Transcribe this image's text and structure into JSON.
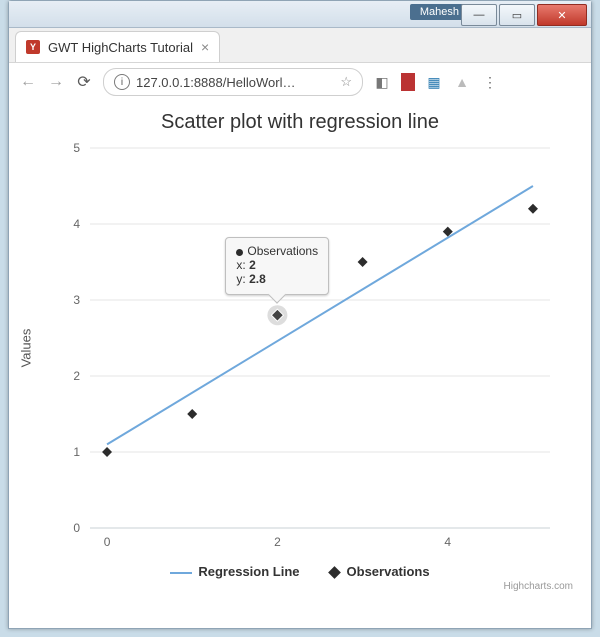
{
  "window": {
    "user": "Mahesh"
  },
  "tab": {
    "title": "GWT HighCharts Tutorial"
  },
  "address": {
    "url": "127.0.0.1:8888/HelloWorl…"
  },
  "chart_data": {
    "type": "scatter",
    "title": "Scatter plot with regression line",
    "xlabel": "",
    "ylabel": "Values",
    "xlim": [
      -0.2,
      5.2
    ],
    "ylim": [
      0,
      5
    ],
    "xticks": [
      0,
      2,
      4
    ],
    "yticks": [
      0,
      1,
      2,
      3,
      4,
      5
    ],
    "series": [
      {
        "name": "Regression Line",
        "type": "line",
        "color": "#6fa8dc",
        "data": [
          [
            0,
            1.1
          ],
          [
            5,
            4.5
          ]
        ]
      },
      {
        "name": "Observations",
        "type": "scatter",
        "color": "#2c2c2c",
        "data": [
          [
            0,
            1.0
          ],
          [
            1,
            1.5
          ],
          [
            2,
            2.8
          ],
          [
            3,
            3.5
          ],
          [
            4,
            3.9
          ],
          [
            5,
            4.2
          ]
        ]
      }
    ],
    "legend": [
      "Regression Line",
      "Observations"
    ],
    "credits": "Highcharts.com"
  },
  "tooltip": {
    "series": "Observations",
    "x_label": "x:",
    "x_value": "2",
    "y_label": "y:",
    "y_value": "2.8",
    "point_index": 2
  }
}
